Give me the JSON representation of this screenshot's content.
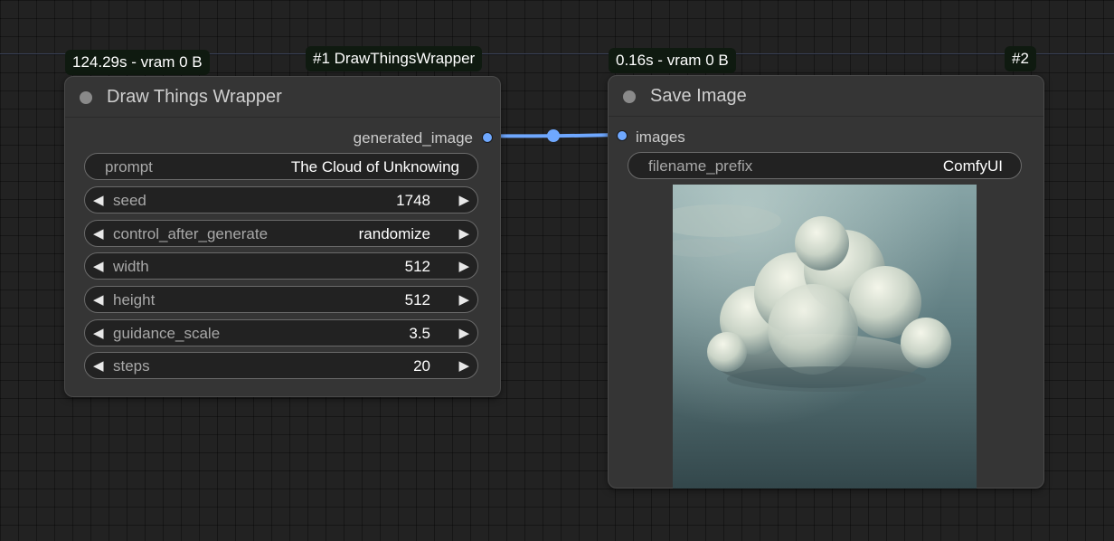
{
  "node1": {
    "badge_time": "124.29s - vram 0 B",
    "badge_id": "#1 DrawThingsWrapper",
    "title": "Draw Things Wrapper",
    "output_label": "generated_image",
    "prompt": {
      "label": "prompt",
      "value": "The Cloud of Unknowing"
    },
    "seed": {
      "label": "seed",
      "value": "1748"
    },
    "control_after_generate": {
      "label": "control_after_generate",
      "value": "randomize"
    },
    "width": {
      "label": "width",
      "value": "512"
    },
    "height": {
      "label": "height",
      "value": "512"
    },
    "guidance_scale": {
      "label": "guidance_scale",
      "value": "3.5"
    },
    "steps": {
      "label": "steps",
      "value": "20"
    }
  },
  "node2": {
    "badge_time": "0.16s - vram 0 B",
    "badge_id": "#2",
    "title": "Save Image",
    "input_label": "images",
    "filename_prefix": {
      "label": "filename_prefix",
      "value": "ComfyUI"
    }
  },
  "icons": {
    "arrow_left": "◀",
    "arrow_right": "▶"
  },
  "colors": {
    "canvas": "#222222",
    "node_body": "#353535",
    "badge_bg": "#0f1a10",
    "link": "#6fa8ff"
  }
}
